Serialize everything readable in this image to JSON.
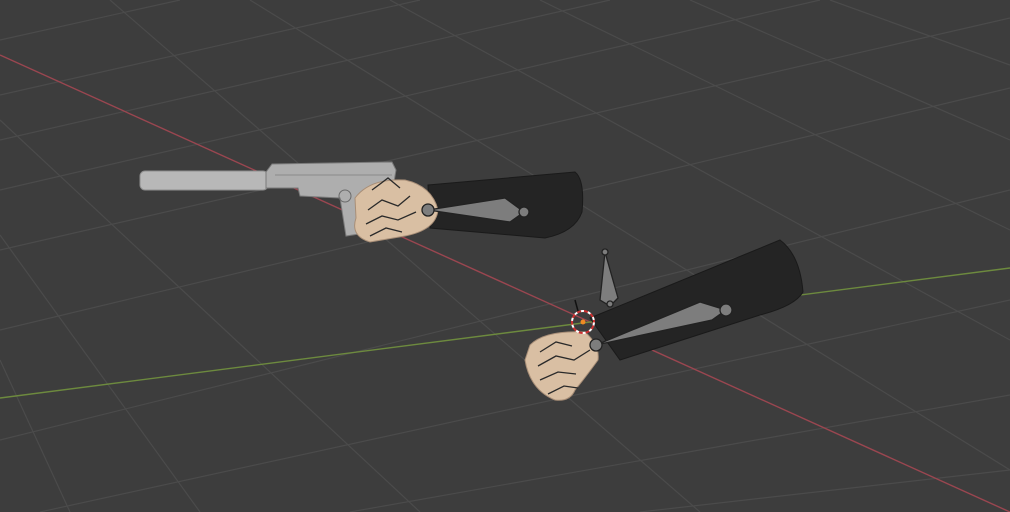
{
  "viewport": {
    "background": "#3d3d3d",
    "grid_color": "#4a4a4a",
    "x_axis_color": "#9a4650",
    "y_axis_color": "#6d8a3e"
  },
  "scene": {
    "objects": [
      "grid-floor",
      "x-axis",
      "y-axis",
      "pistol",
      "arm-with-gun",
      "arm-fist",
      "armature-bones",
      "3d-cursor"
    ]
  }
}
